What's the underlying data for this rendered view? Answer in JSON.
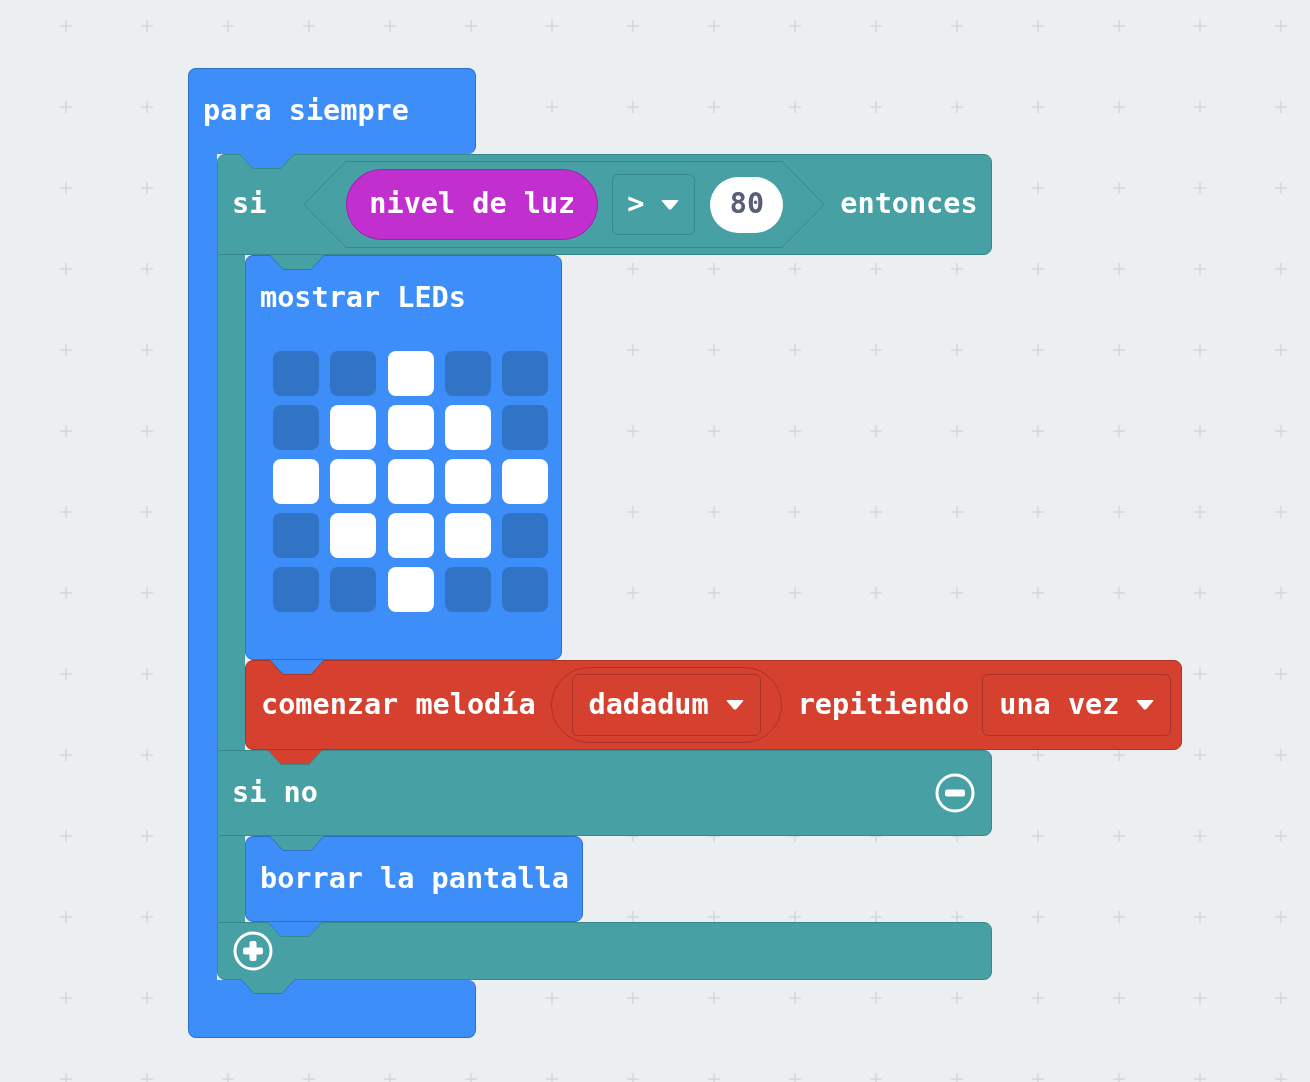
{
  "forever_block": {
    "label": "para siempre",
    "if_block": {
      "if_label": "si",
      "condition": {
        "sensor": "nivel de luz",
        "operator": ">",
        "value": "80"
      },
      "then_label": "entonces",
      "then_blocks": [
        {
          "kind": "show_leds",
          "label": "mostrar LEDs",
          "leds": [
            [
              {
                "on": false
              },
              {
                "on": false
              },
              {
                "on": true
              },
              {
                "on": false
              },
              {
                "on": false
              }
            ],
            [
              {
                "on": false
              },
              {
                "on": true
              },
              {
                "on": true
              },
              {
                "on": true
              },
              {
                "on": false
              }
            ],
            [
              {
                "on": true
              },
              {
                "on": true
              },
              {
                "on": true
              },
              {
                "on": true
              },
              {
                "on": true
              }
            ],
            [
              {
                "on": false
              },
              {
                "on": true
              },
              {
                "on": true
              },
              {
                "on": true
              },
              {
                "on": false
              }
            ],
            [
              {
                "on": false
              },
              {
                "on": false
              },
              {
                "on": true
              },
              {
                "on": false
              },
              {
                "on": false
              }
            ]
          ]
        },
        {
          "kind": "play_melody",
          "label": "comenzar melodía",
          "melody": "dadadum",
          "repeat_label": "repitiendo",
          "repeat": "una vez"
        }
      ],
      "else_label": "si no",
      "else_blocks": [
        {
          "kind": "clear_screen",
          "label": "borrar la pantalla"
        }
      ]
    }
  }
}
